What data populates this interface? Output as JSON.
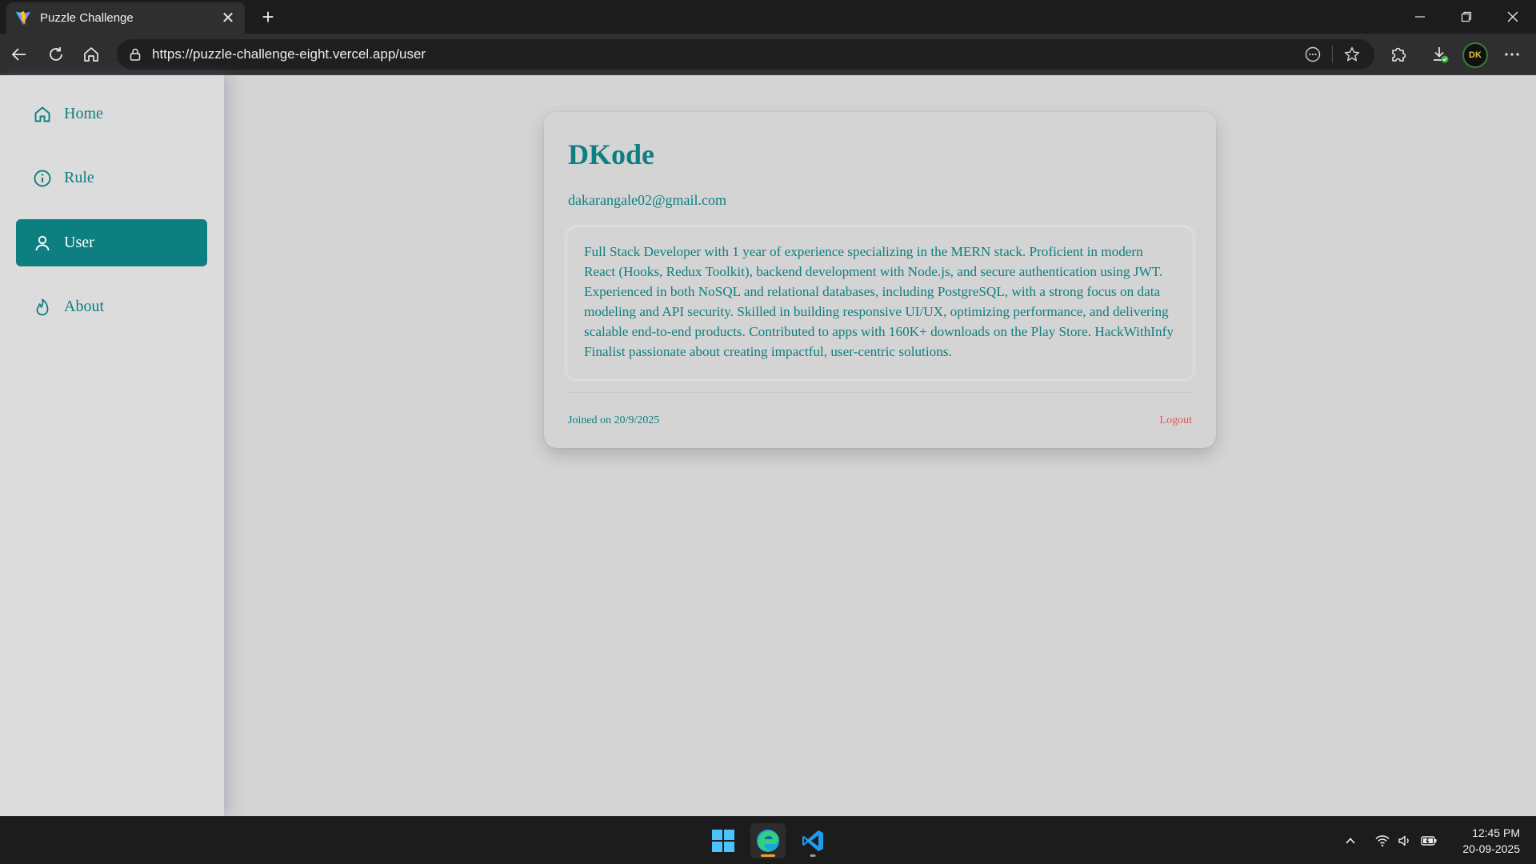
{
  "browser": {
    "tab_title": "Puzzle Challenge",
    "url": "https://puzzle-challenge-eight.vercel.app/user",
    "avatar_initials": "DK"
  },
  "sidebar": {
    "items": [
      {
        "label": "Home",
        "icon": "home-icon",
        "active": false
      },
      {
        "label": "Rule",
        "icon": "info-icon",
        "active": false
      },
      {
        "label": "User",
        "icon": "user-icon",
        "active": true
      },
      {
        "label": "About",
        "icon": "flame-icon",
        "active": false
      }
    ]
  },
  "profile": {
    "name": "DKode",
    "email": "dakarangale02@gmail.com",
    "bio": "Full Stack Developer with 1 year of experience specializing in the MERN stack. Proficient in modern React (Hooks, Redux Toolkit), backend development with Node.js, and secure authentication using JWT. Experienced in both NoSQL and relational databases, including PostgreSQL, with a strong focus on data modeling and API security. Skilled in building responsive UI/UX, optimizing performance, and delivering scalable end-to-end products. Contributed to apps with 160K+ downloads on the Play Store. HackWithInfy Finalist passionate about creating impactful, user-centric solutions.",
    "joined": "Joined on 20/9/2025",
    "logout_label": "Logout"
  },
  "taskbar": {
    "time": "12:45 PM",
    "date": "20-09-2025"
  },
  "colors": {
    "accent": "#0e7f80",
    "logout": "#e0545a",
    "page_bg": "#d4d4d4"
  }
}
